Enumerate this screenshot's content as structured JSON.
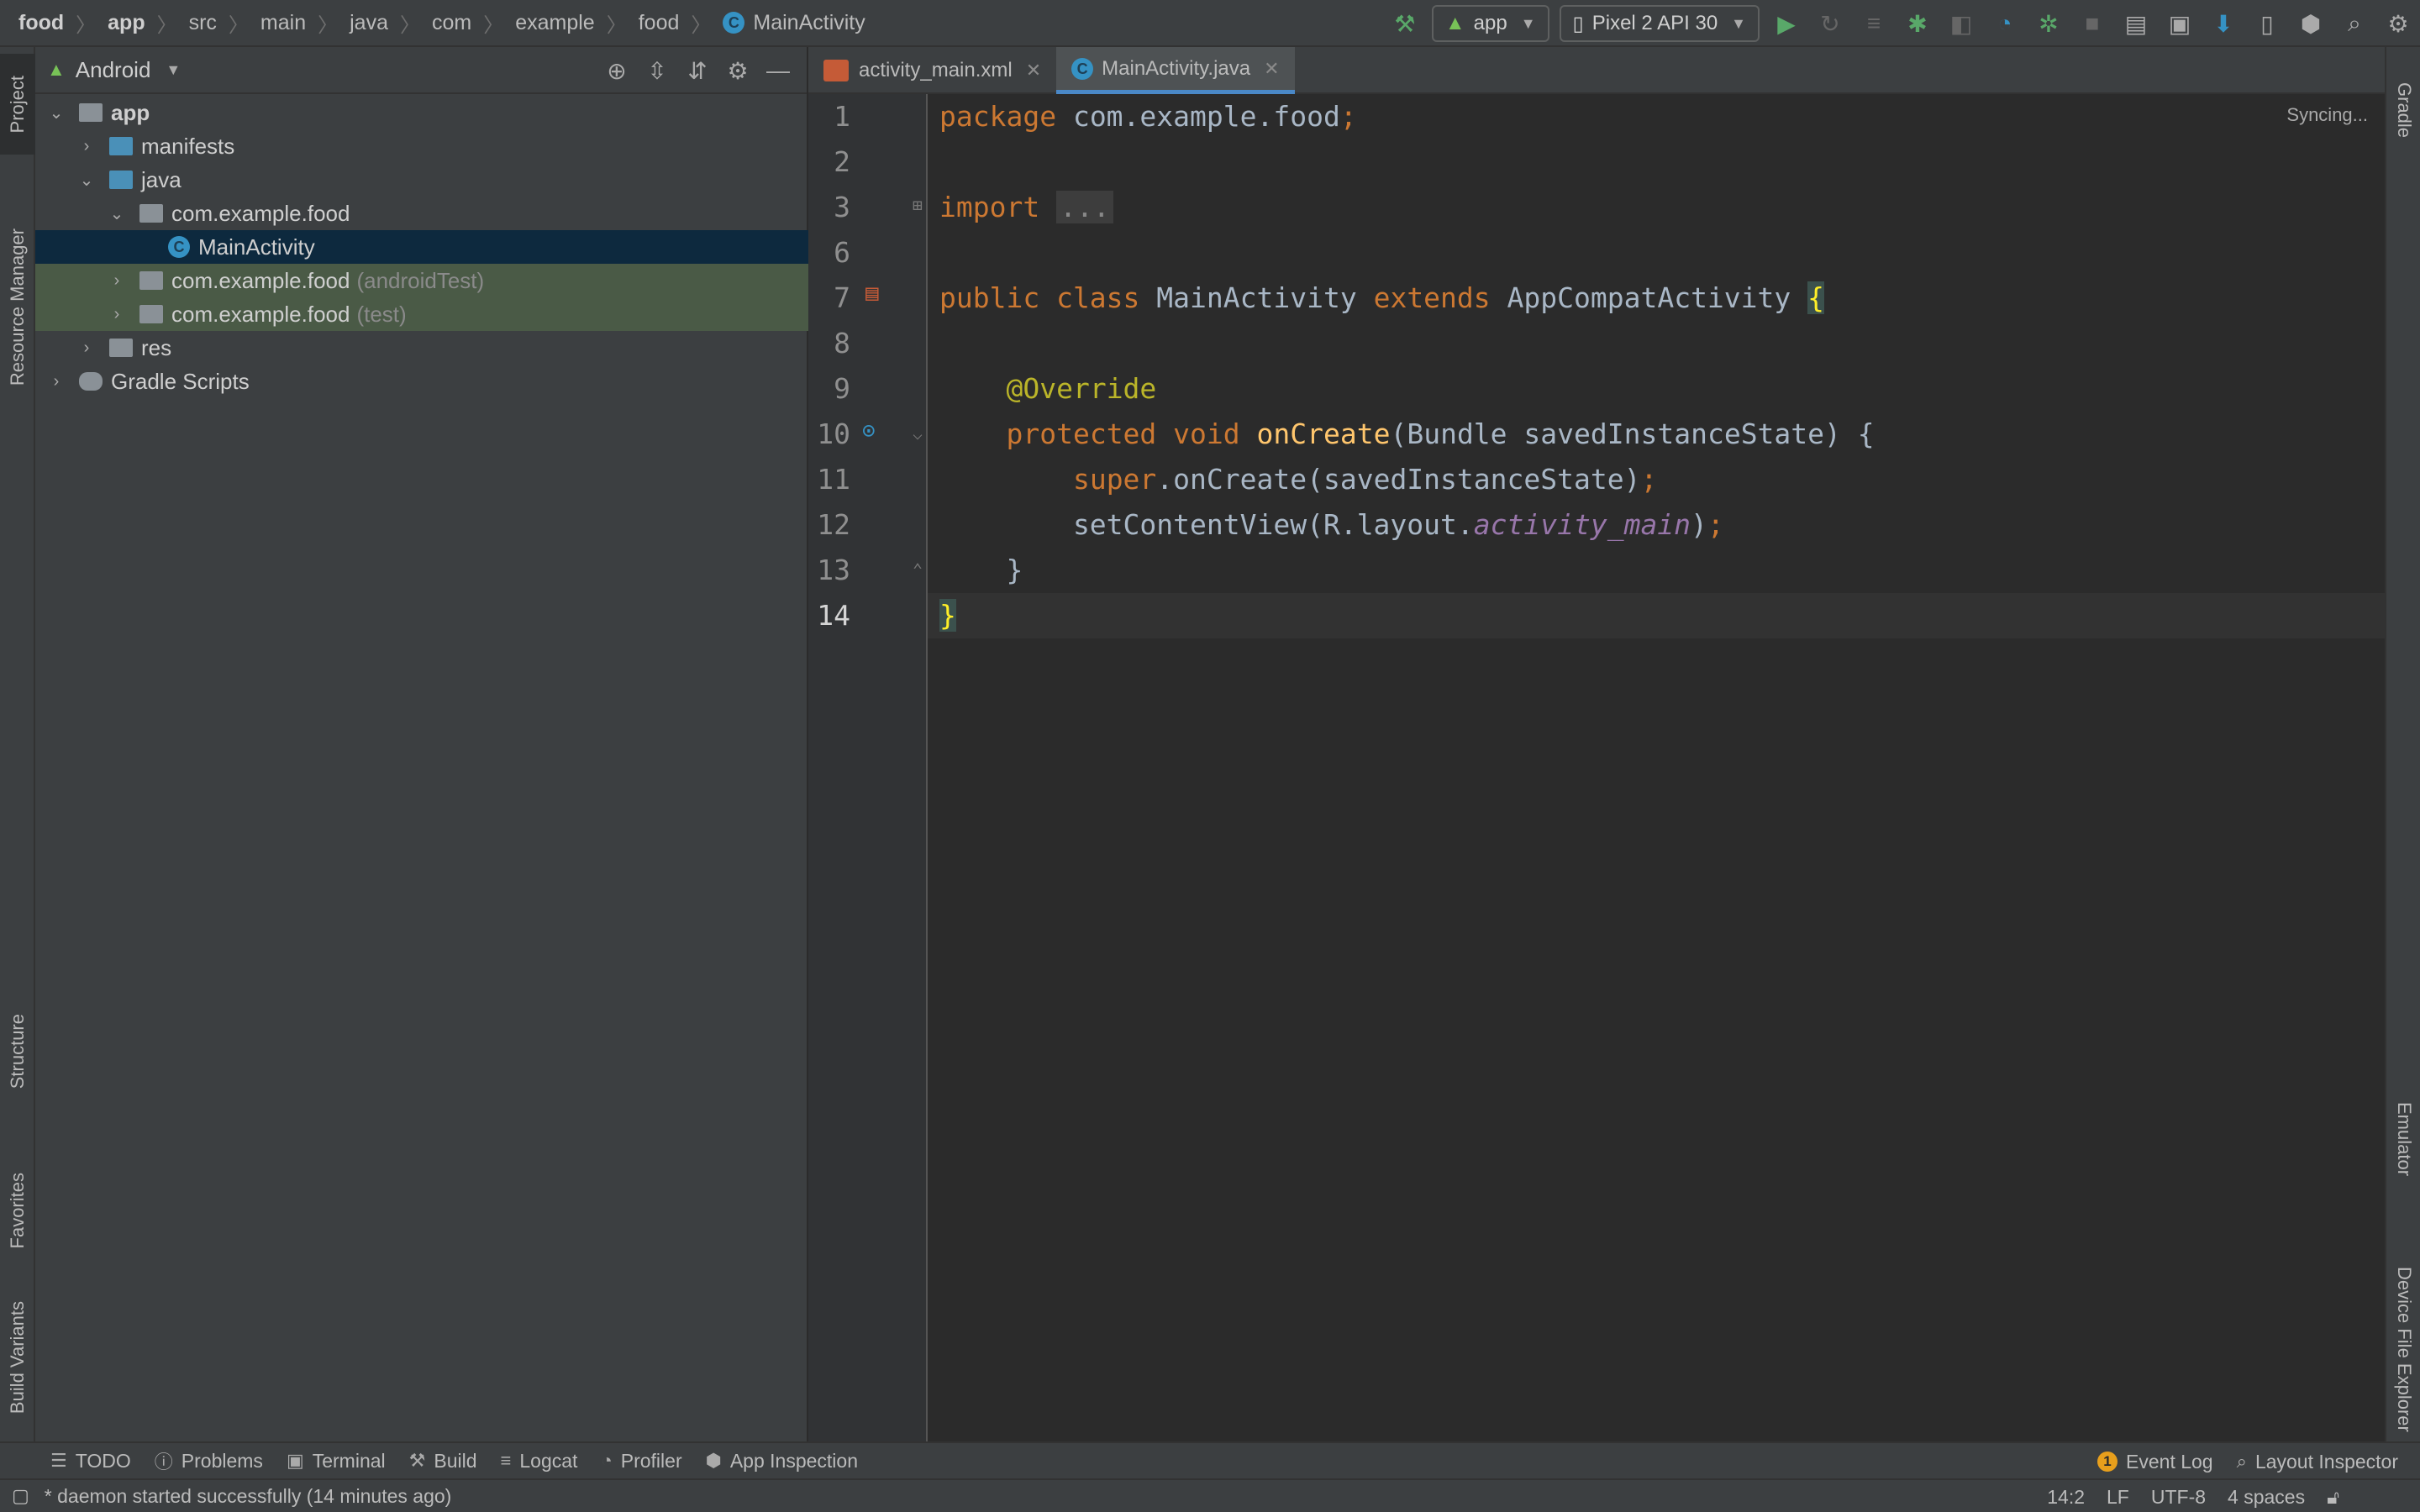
{
  "breadcrumbs": [
    "food",
    "app",
    "src",
    "main",
    "java",
    "com",
    "example",
    "food",
    "MainActivity"
  ],
  "toolbar": {
    "run_config": "app",
    "device": "Pixel 2 API 30"
  },
  "left_tool_windows": [
    "Project",
    "Resource Manager",
    "Structure",
    "Favorites",
    "Build Variants"
  ],
  "right_tool_windows": [
    "Gradle",
    "Emulator",
    "Device File Explorer"
  ],
  "project_panel": {
    "view_mode": "Android",
    "tree": [
      {
        "label": "app",
        "suffix": ""
      },
      {
        "label": "manifests",
        "suffix": ""
      },
      {
        "label": "java",
        "suffix": ""
      },
      {
        "label": "com.example.food",
        "suffix": ""
      },
      {
        "label": "MainActivity",
        "suffix": ""
      },
      {
        "label": "com.example.food",
        "suffix": "(androidTest)"
      },
      {
        "label": "com.example.food",
        "suffix": "(test)"
      },
      {
        "label": "res",
        "suffix": ""
      },
      {
        "label": "Gradle Scripts",
        "suffix": ""
      }
    ]
  },
  "editor_tabs": [
    {
      "label": "activity_main.xml",
      "active": false
    },
    {
      "label": "MainActivity.java",
      "active": true
    }
  ],
  "editor": {
    "status": "Syncing...",
    "line_numbers": [
      "1",
      "2",
      "3",
      "6",
      "7",
      "8",
      "9",
      "10",
      "11",
      "12",
      "13",
      "14"
    ],
    "current_line": "14",
    "lines": [
      {
        "n": "1",
        "tokens": [
          [
            "kw",
            "package"
          ],
          [
            "",
            " com.example.food"
          ],
          [
            "kw",
            ";"
          ]
        ]
      },
      {
        "n": "2",
        "tokens": []
      },
      {
        "n": "3",
        "tokens": [
          [
            "kw",
            "import"
          ],
          [
            "",
            " "
          ],
          [
            "fold",
            "..."
          ]
        ]
      },
      {
        "n": "6",
        "tokens": []
      },
      {
        "n": "7",
        "tokens": [
          [
            "kw",
            "public class"
          ],
          [
            "",
            " MainActivity "
          ],
          [
            "kw",
            "extends"
          ],
          [
            "",
            " AppCompatActivity "
          ],
          [
            "br",
            "{"
          ]
        ]
      },
      {
        "n": "8",
        "tokens": []
      },
      {
        "n": "9",
        "tokens": [
          [
            "",
            "    "
          ],
          [
            "an",
            "@Override"
          ]
        ]
      },
      {
        "n": "10",
        "tokens": [
          [
            "",
            "    "
          ],
          [
            "kw",
            "protected void"
          ],
          [
            "",
            " "
          ],
          [
            "fn",
            "onCreate"
          ],
          [
            "",
            "(Bundle savedInstanceState) {"
          ]
        ]
      },
      {
        "n": "11",
        "tokens": [
          [
            "",
            "        "
          ],
          [
            "kw",
            "super"
          ],
          [
            "",
            ".onCreate(savedInstanceState)"
          ],
          [
            "kw",
            ";"
          ]
        ]
      },
      {
        "n": "12",
        "tokens": [
          [
            "",
            "        setContentView(R.layout."
          ],
          [
            "it",
            "activity_main"
          ],
          [
            "",
            ")"
          ],
          [
            "kw",
            ";"
          ]
        ]
      },
      {
        "n": "13",
        "tokens": [
          [
            "",
            "    }"
          ]
        ]
      },
      {
        "n": "14",
        "tokens": [
          [
            "br",
            "}"
          ]
        ]
      }
    ]
  },
  "bottom_tools": [
    "TODO",
    "Problems",
    "Terminal",
    "Build",
    "Logcat",
    "Profiler",
    "App Inspection"
  ],
  "bottom_right_tools": {
    "event_log": "Event Log",
    "event_count": "1",
    "layout_inspector": "Layout Inspector"
  },
  "status_bar": {
    "message": "* daemon started successfully (14 minutes ago)",
    "position": "14:2",
    "line_sep": "LF",
    "encoding": "UTF-8",
    "indent": "4 spaces"
  }
}
